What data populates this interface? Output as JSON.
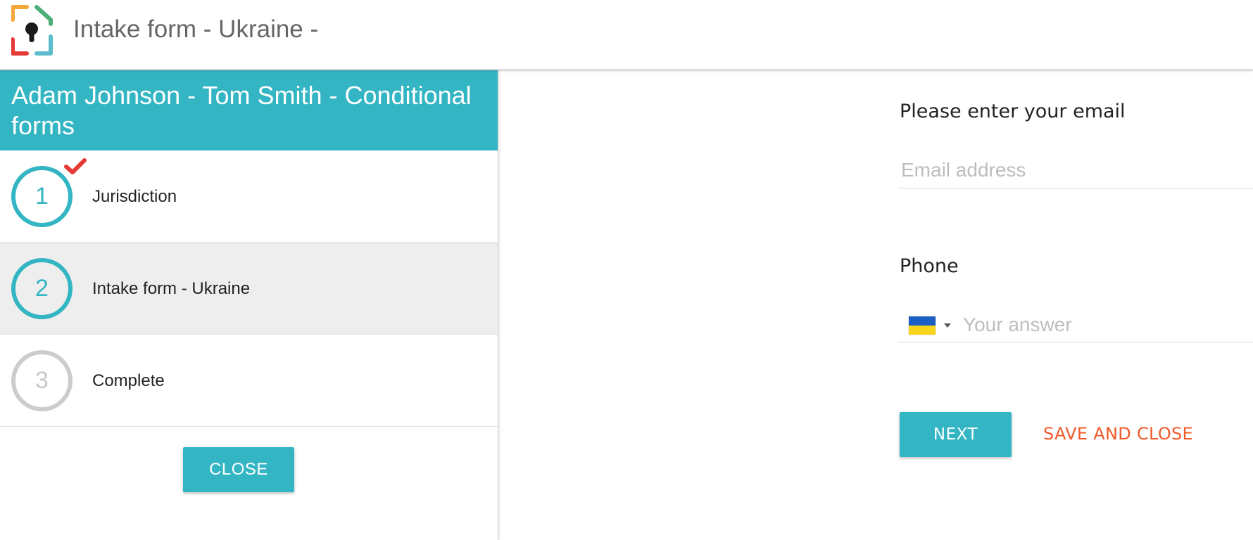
{
  "header": {
    "title": "Intake form - Ukraine -",
    "logo_icon": "keyhole-logo-icon"
  },
  "panel": {
    "title": "Adam Johnson - Tom Smith - Conditional forms",
    "header_color": "#33b5c3"
  },
  "steps": [
    {
      "number": "1",
      "label": "Jurisdiction",
      "status": "completed"
    },
    {
      "number": "2",
      "label": "Intake form - Ukraine",
      "status": "active"
    },
    {
      "number": "3",
      "label": "Complete",
      "status": "pending"
    }
  ],
  "buttons": {
    "close_label": "CLOSE",
    "next_label": "NEXT",
    "save_close_label": "SAVE AND CLOSE"
  },
  "form": {
    "email_label": "Please enter your email",
    "email_placeholder": "Email address",
    "email_value": "",
    "phone_label": "Phone",
    "phone_placeholder": "Your answer",
    "phone_value": "",
    "phone_country_icon": "ukraine-flag-icon"
  },
  "colors": {
    "accent": "#33b5c3",
    "link": "#f05a2a",
    "check": "#e53935"
  }
}
